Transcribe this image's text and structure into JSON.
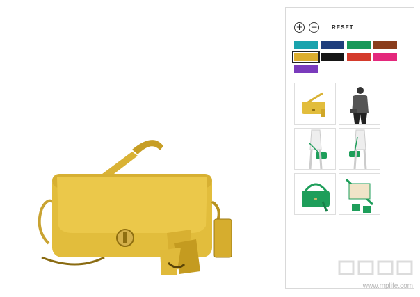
{
  "toolbar": {
    "zoom_in_label": "+",
    "zoom_out_label": "−",
    "reset_label": "RESET"
  },
  "swatches": [
    {
      "name": "teal",
      "color": "#1aa3ad"
    },
    {
      "name": "navy",
      "color": "#1f3e7c"
    },
    {
      "name": "green",
      "color": "#19995a"
    },
    {
      "name": "brown",
      "color": "#8a3d1c"
    },
    {
      "name": "mustard",
      "color": "#dcae2e",
      "selected": true
    },
    {
      "name": "black",
      "color": "#161616"
    },
    {
      "name": "red",
      "color": "#d43b2c"
    },
    {
      "name": "pink",
      "color": "#e4287c"
    },
    {
      "name": "purple",
      "color": "#7a3bbc"
    }
  ],
  "thumbnails": [
    {
      "name": "thumb-bag-mustard"
    },
    {
      "name": "thumb-model"
    },
    {
      "name": "thumb-model-green-1"
    },
    {
      "name": "thumb-model-green-2"
    },
    {
      "name": "thumb-bag-green"
    },
    {
      "name": "thumb-bag-green-detail"
    }
  ],
  "watermark": {
    "url": "www.mplife.com"
  },
  "colors": {
    "bag_main": "#e2bd3c",
    "bag_dark": "#b8921f",
    "green_bag": "#1e9e5a"
  }
}
